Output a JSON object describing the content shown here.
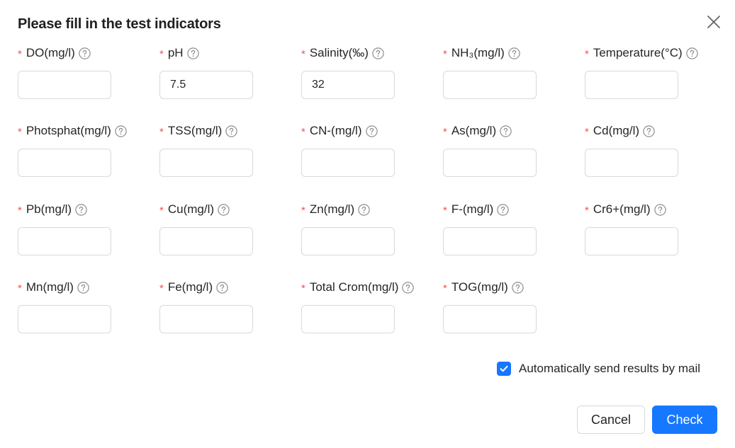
{
  "dialog": {
    "title": "Please fill in the test indicators",
    "close_icon": "close-icon"
  },
  "fields": [
    {
      "label": "DO(mg/l)",
      "value": "",
      "required": true
    },
    {
      "label": "pH",
      "value": "7.5",
      "required": true
    },
    {
      "label": "Salinity(‰)",
      "value": "32",
      "required": true
    },
    {
      "label": "NH₃(mg/l)",
      "value": "",
      "required": true
    },
    {
      "label": "Temperature(°C)",
      "value": "",
      "required": true
    },
    {
      "label": "Photsphat(mg/l)",
      "value": "",
      "required": true
    },
    {
      "label": "TSS(mg/l)",
      "value": "",
      "required": true
    },
    {
      "label": "CN-(mg/l)",
      "value": "",
      "required": true
    },
    {
      "label": "As(mg/l)",
      "value": "",
      "required": true
    },
    {
      "label": "Cd(mg/l)",
      "value": "",
      "required": true
    },
    {
      "label": "Pb(mg/l)",
      "value": "",
      "required": true
    },
    {
      "label": "Cu(mg/l)",
      "value": "",
      "required": true
    },
    {
      "label": "Zn(mg/l)",
      "value": "",
      "required": true
    },
    {
      "label": "F-(mg/l)",
      "value": "",
      "required": true
    },
    {
      "label": "Cr6+(mg/l)",
      "value": "",
      "required": true
    },
    {
      "label": "Mn(mg/l)",
      "value": "",
      "required": true
    },
    {
      "label": "Fe(mg/l)",
      "value": "",
      "required": true
    },
    {
      "label": "Total Crom(mg/l)",
      "value": "",
      "required": true
    },
    {
      "label": "TOG(mg/l)",
      "value": "",
      "required": true
    }
  ],
  "required_mark": "*",
  "auto_mail": {
    "checked": true,
    "label": "Automatically send results by mail"
  },
  "actions": {
    "cancel_label": "Cancel",
    "check_label": "Check"
  },
  "colors": {
    "primary": "#1677ff",
    "required": "#ff4d4f",
    "border": "#d9d9d9"
  }
}
